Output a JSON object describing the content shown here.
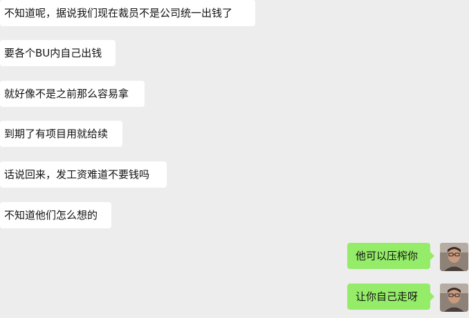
{
  "chat": {
    "incoming": [
      {
        "text": "不知道呢，据说我们现在裁员不是公司统一出钱了"
      },
      {
        "text": "要各个BU内自己出钱"
      },
      {
        "text": "就好像不是之前那么容易拿"
      },
      {
        "text": "到期了有项目用就给续"
      },
      {
        "text": "话说回来，发工资难道不要钱吗"
      },
      {
        "text": "不知道他们怎么想的"
      }
    ],
    "outgoing": [
      {
        "text": "他可以压榨你",
        "avatar_icon": "user-avatar-photo"
      },
      {
        "text": "让你自己走呀",
        "avatar_icon": "user-avatar-photo"
      }
    ]
  },
  "colors": {
    "background": "#ededed",
    "incoming_bubble": "#ffffff",
    "outgoing_bubble": "#95ec69",
    "text": "#111111"
  }
}
